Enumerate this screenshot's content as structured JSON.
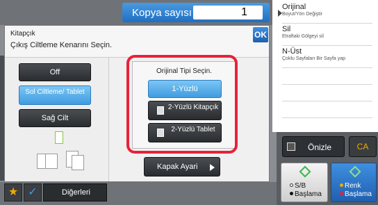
{
  "header": {
    "copies_label": "Kopya sayısı",
    "copies_value": "1"
  },
  "side_panel": {
    "items": [
      {
        "title": "Orijinal",
        "subtitle": "Boyut/Yön Değiştir"
      },
      {
        "title": "Sil",
        "subtitle": "Etraftaki Gölgeyi sil"
      },
      {
        "title": "N-Üst",
        "subtitle": "Çoklu Sayfaları Bir Sayfa yap"
      }
    ]
  },
  "actions": {
    "preview_label": "Önizle",
    "ca_label": "CA"
  },
  "start": {
    "bw": {
      "line1": "S/B",
      "line2": "Başlama"
    },
    "color": {
      "line1": "Renk",
      "line2": "Başlama"
    }
  },
  "dialog": {
    "title": "Kitapçık",
    "subtitle": "Çıkış Ciltleme Kenarını Seçin.",
    "ok_label": "OK",
    "binding_options": [
      {
        "label": "Off",
        "selected": false
      },
      {
        "label": "Sol Ciltleme/ Tablet",
        "selected": true
      },
      {
        "label": "Sağ Cilt",
        "selected": false
      }
    ],
    "original_type": {
      "label": "Orijinal Tipi Seçin.",
      "options": [
        {
          "label": "1-Yüzlü",
          "selected": true
        },
        {
          "label": "2-Yüzlü Kitapçık",
          "selected": false
        },
        {
          "label": "2-Yüzlü Tablet",
          "selected": false
        }
      ]
    },
    "cover_label": "Kapak Ayari"
  },
  "footer": {
    "others_label": "Diğerleri"
  },
  "colors": {
    "accent_blue": "#3f9ce0",
    "highlight_red": "#e8213a",
    "start_green": "#3cb34a"
  }
}
